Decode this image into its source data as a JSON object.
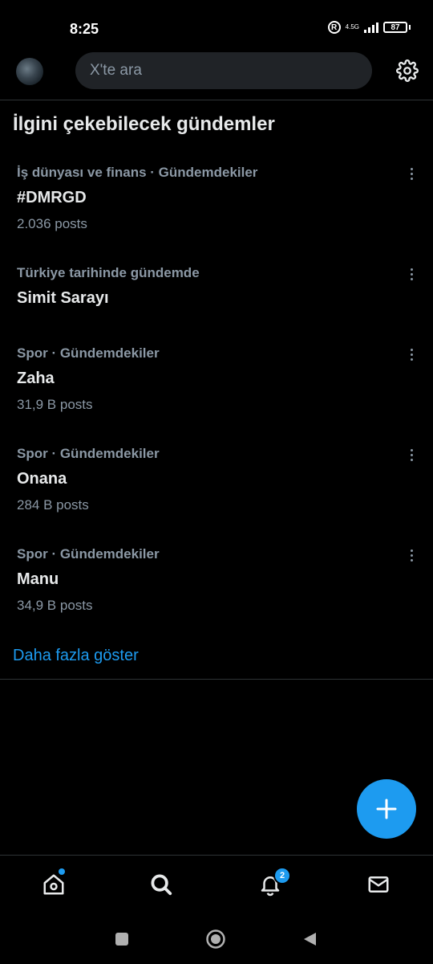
{
  "status": {
    "time": "8:25",
    "network": "4.5G",
    "battery": "87"
  },
  "search": {
    "placeholder": "X'te ara"
  },
  "section_title": "İlgini çekebilecek gündemler",
  "trends": [
    {
      "category": "İş dünyası ve finans · Gündemdekiler",
      "name": "#DMRGD",
      "count": "2.036 posts"
    },
    {
      "category": "Türkiye tarihinde gündemde",
      "name": "Simit Sarayı",
      "count": ""
    },
    {
      "category": "Spor · Gündemdekiler",
      "name": "Zaha",
      "count": "31,9 B posts"
    },
    {
      "category": "Spor · Gündemdekiler",
      "name": "Onana",
      "count": "284 B posts"
    },
    {
      "category": "Spor · Gündemdekiler",
      "name": "Manu",
      "count": "34,9 B posts"
    }
  ],
  "show_more": "Daha fazla göster",
  "notifications_badge": "2",
  "colors": {
    "accent": "#1d9bf0",
    "background": "#000000",
    "secondary_text": "#8b98a5"
  }
}
